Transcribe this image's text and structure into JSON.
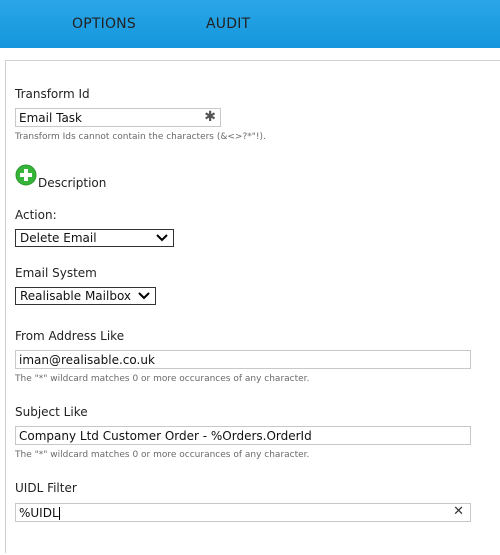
{
  "tabs": [
    {
      "label": "OPTIONS"
    },
    {
      "label": "AUDIT"
    }
  ],
  "form": {
    "transform_id": {
      "label": "Transform Id",
      "value": "Email Task",
      "hint": "Transform Ids cannot contain the characters (&<>?*\"!)."
    },
    "description": {
      "label": "Description"
    },
    "action": {
      "label": "Action:",
      "value": "Delete Email"
    },
    "email_system": {
      "label": "Email System",
      "value": "Realisable Mailbox"
    },
    "from_address": {
      "label": "From Address Like",
      "value": "iman@realisable.co.uk",
      "hint": "The \"*\" wildcard matches 0 or more occurances of any character."
    },
    "subject": {
      "label": "Subject Like",
      "value": "Company Ltd Customer Order - %Orders.OrderId",
      "hint": "The \"*\" wildcard matches 0 or more occurances of any character."
    },
    "uidl": {
      "label": "UIDL Filter",
      "value": "%UIDL"
    }
  },
  "icons": {
    "required": "asterisk-icon",
    "add": "plus-circle-icon",
    "clear": "clear-x-icon",
    "dropdown": "chevron-down-icon"
  },
  "colors": {
    "topbar": "#1596dc",
    "add_icon": "#36b339"
  }
}
